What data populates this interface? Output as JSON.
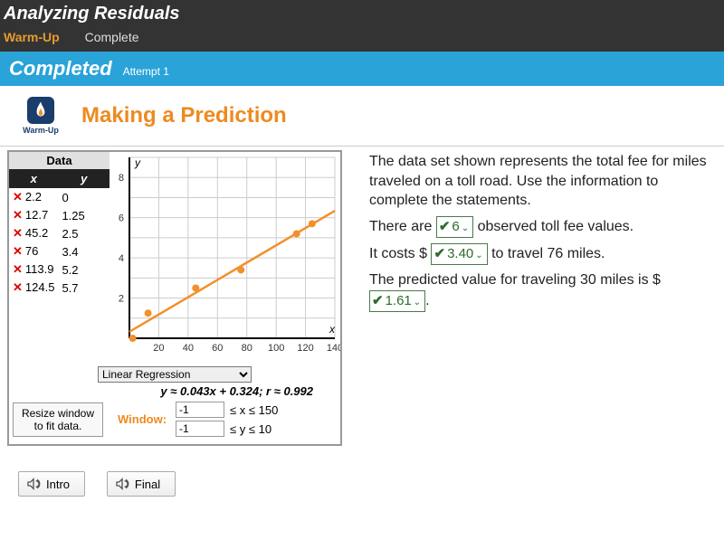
{
  "header": {
    "title": "Analyzing Residuals",
    "tab_warmup": "Warm-Up",
    "tab_complete": "Complete"
  },
  "status": {
    "label": "Completed",
    "attempt": "Attempt 1"
  },
  "lesson": {
    "badge_text": "Warm-Up",
    "title": "Making a Prediction"
  },
  "data_table": {
    "title": "Data",
    "col_x": "x",
    "col_y": "y",
    "rows": [
      {
        "x": "2.2",
        "y": "0"
      },
      {
        "x": "12.7",
        "y": "1.25"
      },
      {
        "x": "45.2",
        "y": "2.5"
      },
      {
        "x": "76",
        "y": "3.4"
      },
      {
        "x": "113.9",
        "y": "5.2"
      },
      {
        "x": "124.5",
        "y": "5.7"
      }
    ]
  },
  "chart_data": {
    "type": "scatter",
    "title": "",
    "xlabel": "x",
    "ylabel": "y",
    "xlim": [
      0,
      140
    ],
    "ylim": [
      0,
      9
    ],
    "x_ticks": [
      20,
      40,
      60,
      80,
      100,
      120,
      140
    ],
    "y_ticks": [
      2,
      4,
      6,
      8
    ],
    "series": [
      {
        "name": "points",
        "type": "scatter",
        "x": [
          2.2,
          12.7,
          45.2,
          76,
          113.9,
          124.5
        ],
        "y": [
          0,
          1.25,
          2.5,
          3.4,
          5.2,
          5.7
        ]
      }
    ],
    "regression_line": {
      "slope": 0.043,
      "intercept": 0.324,
      "x_range": [
        0,
        140
      ]
    }
  },
  "regression": {
    "select_label": "Linear Regression",
    "equation": "y ≈ 0.043x + 0.324; r ≈ 0.992"
  },
  "window": {
    "resize_label": "Resize window to fit data.",
    "label": "Window:",
    "xmin": "-1",
    "xmax": "150",
    "ymin": "-1",
    "ymax": "10",
    "xtext": "≤ x ≤",
    "ytext": "≤ y ≤"
  },
  "prose": {
    "p1": "The data set shown represents the total fee for miles traveled on a toll road. Use the information to complete the statements.",
    "p2a": "There are ",
    "p2b": " observed toll fee values.",
    "p3a": "It costs $",
    "p3b": " to travel 76 miles.",
    "p4a": "The predicted value for traveling 30 miles is $",
    "p4b": "."
  },
  "answers": {
    "count": "6",
    "cost76": "3.40",
    "pred30": "1.61"
  },
  "footer": {
    "intro": "Intro",
    "final": "Final"
  }
}
